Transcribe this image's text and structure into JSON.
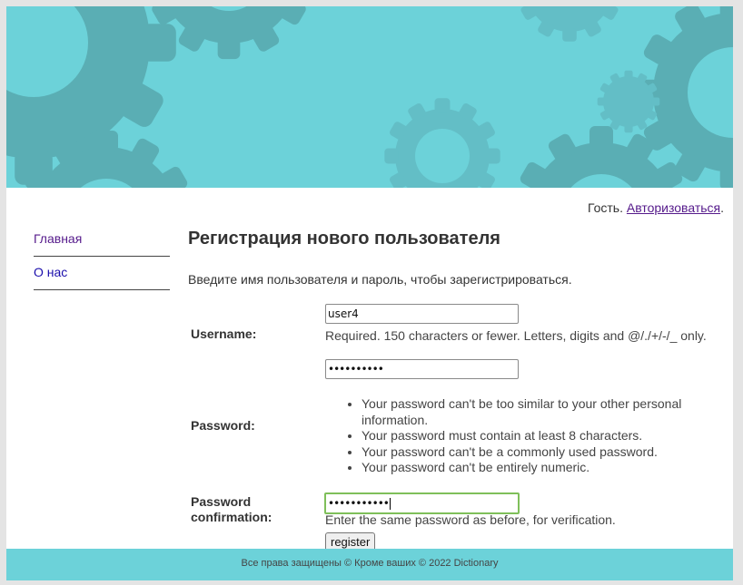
{
  "header": {
    "guest_text": "Гость.",
    "login_link": "Авторизоваться",
    "period": "."
  },
  "sidebar": {
    "items": [
      {
        "label": "Главная"
      },
      {
        "label": "О нас"
      }
    ]
  },
  "main": {
    "title": "Регистрация нового пользователя",
    "intro": "Введите имя пользователя и пароль, чтобы зарегистрироваться.",
    "username": {
      "label": "Username:",
      "value": "user4",
      "help": "Required. 150 characters or fewer. Letters, digits and @/./+/-/_ only."
    },
    "password": {
      "label": "Password:",
      "value": "••••••••••",
      "rules": [
        "Your password can't be too similar to your other personal information.",
        "Your password must contain at least 8 characters.",
        "Your password can't be a commonly used password.",
        "Your password can't be entirely numeric."
      ]
    },
    "password_confirmation": {
      "label": "Password confirmation:",
      "value": "•••••••••••",
      "help": "Enter the same password as before, for verification."
    },
    "submit_label": "register"
  },
  "footer": {
    "text": "Все права защищены © Кроме ваших © 2022 Dictionary"
  },
  "colors": {
    "banner": "#6cd2d9",
    "gear_dark": "#5aaeb4",
    "gear_mid": "#63bec6",
    "visited_link": "#551a8b",
    "focus_ring": "#7fbf5a"
  }
}
